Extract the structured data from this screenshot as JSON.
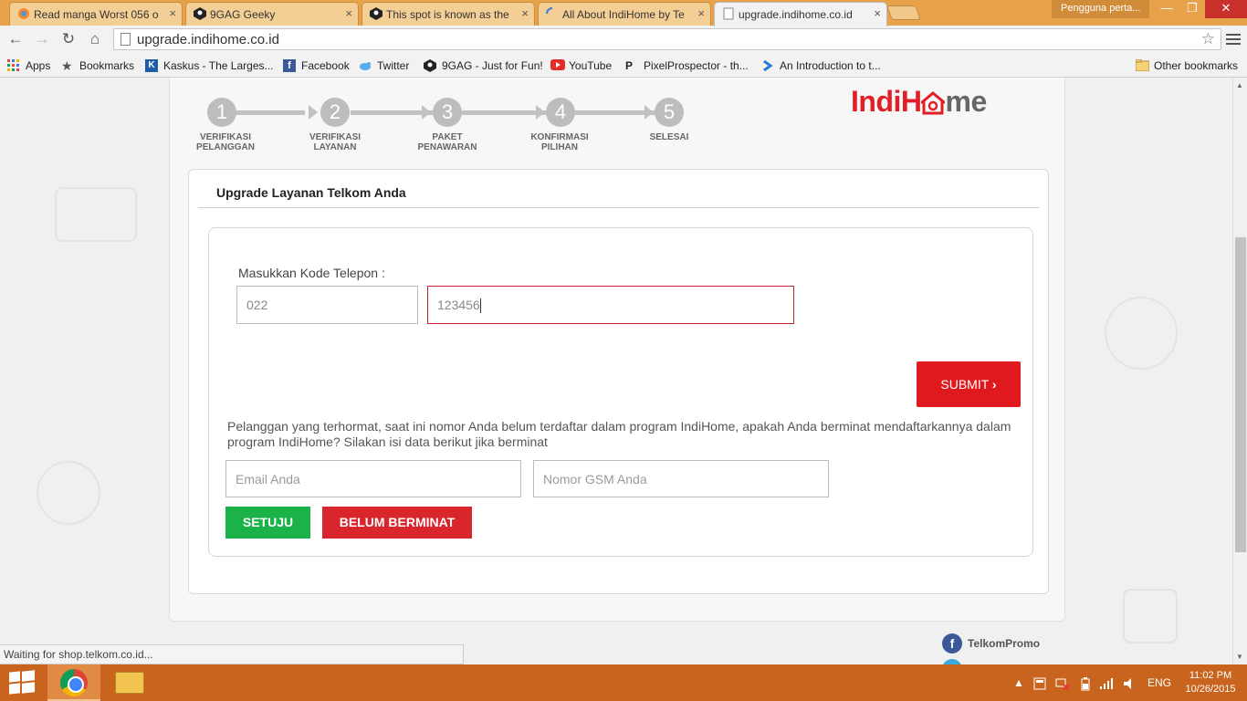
{
  "browser": {
    "tabs": [
      {
        "title": "Read manga Worst 056 o",
        "color": "#e44"
      },
      {
        "title": "9GAG Geeky",
        "color": "#222"
      },
      {
        "title": "This spot is known as the",
        "color": "#222"
      },
      {
        "title": "All About IndiHome by Te",
        "color": "#3b7be4"
      },
      {
        "title": "upgrade.indihome.co.id",
        "color": "#999"
      }
    ],
    "profile": "Pengguna perta...",
    "url": "upgrade.indihome.co.id",
    "bookmarks": [
      {
        "label": "Apps"
      },
      {
        "label": "Bookmarks"
      },
      {
        "label": "Kaskus - The Larges..."
      },
      {
        "label": "Facebook"
      },
      {
        "label": "Twitter"
      },
      {
        "label": "9GAG - Just for Fun!"
      },
      {
        "label": "YouTube"
      },
      {
        "label": "PixelProspector - th..."
      },
      {
        "label": "An Introduction to t..."
      }
    ],
    "other_bookmarks": "Other bookmarks",
    "status": "Waiting for shop.telkom.co.id..."
  },
  "steps": [
    {
      "num": "1",
      "line1": "VERIFIKASI",
      "line2": "PELANGGAN"
    },
    {
      "num": "2",
      "line1": "VERIFIKASI",
      "line2": "LAYANAN"
    },
    {
      "num": "3",
      "line1": "PAKET",
      "line2": "PENAWARAN"
    },
    {
      "num": "4",
      "line1": "KONFIRMASI",
      "line2": "PILIHAN"
    },
    {
      "num": "5",
      "line1": "SELESAI",
      "line2": ""
    }
  ],
  "logo": {
    "part1": "IndiH",
    "part2": "me",
    "o_color": "#e21f26"
  },
  "form": {
    "title": "Upgrade Layanan Telkom Anda",
    "phone_label": "Masukkan Kode Telepon :",
    "area_code": "022",
    "phone_number": "123456",
    "submit": "SUBMIT",
    "notice": "Pelanggan yang terhormat, saat ini nomor Anda belum terdaftar dalam program IndiHome, apakah Anda berminat mendaftarkannya dalam program IndiHome? Silakan isi data berikut jika berminat",
    "email_placeholder": "Email Anda",
    "gsm_placeholder": "Nomor GSM Anda",
    "agree": "SETUJU",
    "decline": "BELUM BERMINAT"
  },
  "social": {
    "facebook": "TelkomPromo"
  },
  "taskbar": {
    "language": "ENG",
    "time": "11:02 PM",
    "date": "10/26/2015"
  },
  "colors": {
    "brand_red": "#e0191f",
    "green": "#1bb24a",
    "taskbar": "#c9641f"
  }
}
